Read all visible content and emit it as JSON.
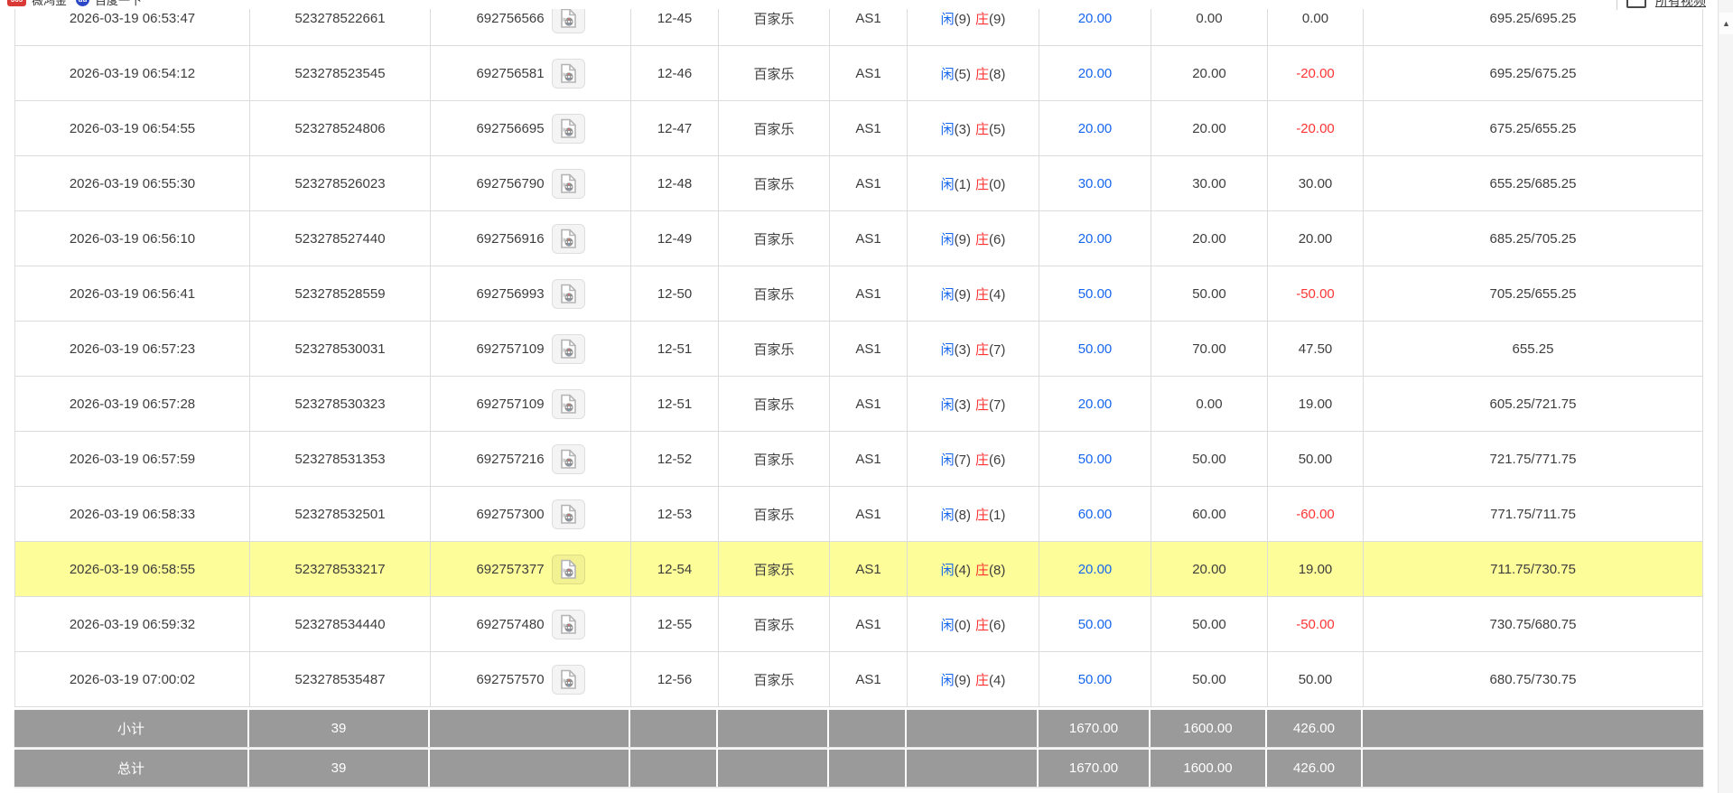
{
  "bookmarks_bar": {
    "items": [
      {
        "label": "薇鸿金",
        "badge": "365",
        "badge_type": "red"
      },
      {
        "label": "百度一下",
        "badge": "du",
        "badge_type": "blue"
      }
    ]
  },
  "header": {
    "all_videos_label": "所有视频"
  },
  "scrollbar": {
    "up_arrow": "▲"
  },
  "table": {
    "rows": [
      {
        "time": "2026-03-19 06:53:47",
        "order_no": "523278522661",
        "session_no": "692756566",
        "round": "12-45",
        "game": "百家乐",
        "table": "AS1",
        "xian": "闲",
        "xian_n": "(9)",
        "zhuang": "庄",
        "zhuang_n": "(9)",
        "bet": "20.00",
        "valid": "0.00",
        "win_loss": "0.00",
        "win_negative": false,
        "balance": "695.25/695.25",
        "highlight": false
      },
      {
        "time": "2026-03-19 06:54:12",
        "order_no": "523278523545",
        "session_no": "692756581",
        "round": "12-46",
        "game": "百家乐",
        "table": "AS1",
        "xian": "闲",
        "xian_n": "(5)",
        "zhuang": "庄",
        "zhuang_n": "(8)",
        "bet": "20.00",
        "valid": "20.00",
        "win_loss": "-20.00",
        "win_negative": true,
        "balance": "695.25/675.25",
        "highlight": false
      },
      {
        "time": "2026-03-19 06:54:55",
        "order_no": "523278524806",
        "session_no": "692756695",
        "round": "12-47",
        "game": "百家乐",
        "table": "AS1",
        "xian": "闲",
        "xian_n": "(3)",
        "zhuang": "庄",
        "zhuang_n": "(5)",
        "bet": "20.00",
        "valid": "20.00",
        "win_loss": "-20.00",
        "win_negative": true,
        "balance": "675.25/655.25",
        "highlight": false
      },
      {
        "time": "2026-03-19 06:55:30",
        "order_no": "523278526023",
        "session_no": "692756790",
        "round": "12-48",
        "game": "百家乐",
        "table": "AS1",
        "xian": "闲",
        "xian_n": "(1)",
        "zhuang": "庄",
        "zhuang_n": "(0)",
        "bet": "30.00",
        "valid": "30.00",
        "win_loss": "30.00",
        "win_negative": false,
        "balance": "655.25/685.25",
        "highlight": false
      },
      {
        "time": "2026-03-19 06:56:10",
        "order_no": "523278527440",
        "session_no": "692756916",
        "round": "12-49",
        "game": "百家乐",
        "table": "AS1",
        "xian": "闲",
        "xian_n": "(9)",
        "zhuang": "庄",
        "zhuang_n": "(6)",
        "bet": "20.00",
        "valid": "20.00",
        "win_loss": "20.00",
        "win_negative": false,
        "balance": "685.25/705.25",
        "highlight": false
      },
      {
        "time": "2026-03-19 06:56:41",
        "order_no": "523278528559",
        "session_no": "692756993",
        "round": "12-50",
        "game": "百家乐",
        "table": "AS1",
        "xian": "闲",
        "xian_n": "(9)",
        "zhuang": "庄",
        "zhuang_n": "(4)",
        "bet": "50.00",
        "valid": "50.00",
        "win_loss": "-50.00",
        "win_negative": true,
        "balance": "705.25/655.25",
        "highlight": false
      },
      {
        "time": "2026-03-19 06:57:23",
        "order_no": "523278530031",
        "session_no": "692757109",
        "round": "12-51",
        "game": "百家乐",
        "table": "AS1",
        "xian": "闲",
        "xian_n": "(3)",
        "zhuang": "庄",
        "zhuang_n": "(7)",
        "bet": "50.00",
        "valid": "70.00",
        "win_loss": "47.50",
        "win_negative": false,
        "balance": "655.25",
        "highlight": false
      },
      {
        "time": "2026-03-19 06:57:28",
        "order_no": "523278530323",
        "session_no": "692757109",
        "round": "12-51",
        "game": "百家乐",
        "table": "AS1",
        "xian": "闲",
        "xian_n": "(3)",
        "zhuang": "庄",
        "zhuang_n": "(7)",
        "bet": "20.00",
        "valid": "0.00",
        "win_loss": "19.00",
        "win_negative": false,
        "balance": "605.25/721.75",
        "highlight": false
      },
      {
        "time": "2026-03-19 06:57:59",
        "order_no": "523278531353",
        "session_no": "692757216",
        "round": "12-52",
        "game": "百家乐",
        "table": "AS1",
        "xian": "闲",
        "xian_n": "(7)",
        "zhuang": "庄",
        "zhuang_n": "(6)",
        "bet": "50.00",
        "valid": "50.00",
        "win_loss": "50.00",
        "win_negative": false,
        "balance": "721.75/771.75",
        "highlight": false
      },
      {
        "time": "2026-03-19 06:58:33",
        "order_no": "523278532501",
        "session_no": "692757300",
        "round": "12-53",
        "game": "百家乐",
        "table": "AS1",
        "xian": "闲",
        "xian_n": "(8)",
        "zhuang": "庄",
        "zhuang_n": "(1)",
        "bet": "60.00",
        "valid": "60.00",
        "win_loss": "-60.00",
        "win_negative": true,
        "balance": "771.75/711.75",
        "highlight": false
      },
      {
        "time": "2026-03-19 06:58:55",
        "order_no": "523278533217",
        "session_no": "692757377",
        "round": "12-54",
        "game": "百家乐",
        "table": "AS1",
        "xian": "闲",
        "xian_n": "(4)",
        "zhuang": "庄",
        "zhuang_n": "(8)",
        "bet": "20.00",
        "valid": "20.00",
        "win_loss": "19.00",
        "win_negative": false,
        "balance": "711.75/730.75",
        "highlight": true
      },
      {
        "time": "2026-03-19 06:59:32",
        "order_no": "523278534440",
        "session_no": "692757480",
        "round": "12-55",
        "game": "百家乐",
        "table": "AS1",
        "xian": "闲",
        "xian_n": "(0)",
        "zhuang": "庄",
        "zhuang_n": "(6)",
        "bet": "50.00",
        "valid": "50.00",
        "win_loss": "-50.00",
        "win_negative": true,
        "balance": "730.75/680.75",
        "highlight": false
      },
      {
        "time": "2026-03-19 07:00:02",
        "order_no": "523278535487",
        "session_no": "692757570",
        "round": "12-56",
        "game": "百家乐",
        "table": "AS1",
        "xian": "闲",
        "xian_n": "(9)",
        "zhuang": "庄",
        "zhuang_n": "(4)",
        "bet": "50.00",
        "valid": "50.00",
        "win_loss": "50.00",
        "win_negative": false,
        "balance": "680.75/730.75",
        "highlight": false
      }
    ]
  },
  "summary": {
    "rows": [
      {
        "label": "小计",
        "count": "39",
        "bet": "1670.00",
        "valid": "1600.00",
        "win_loss": "426.00"
      },
      {
        "label": "总计",
        "count": "39",
        "bet": "1670.00",
        "valid": "1600.00",
        "win_loss": "426.00"
      }
    ]
  },
  "colors": {
    "accent_blue": "#1766ee",
    "loss_red": "#ff3434",
    "highlight_yellow": "#fdfd99",
    "summary_gray": "#9a9a9a"
  }
}
